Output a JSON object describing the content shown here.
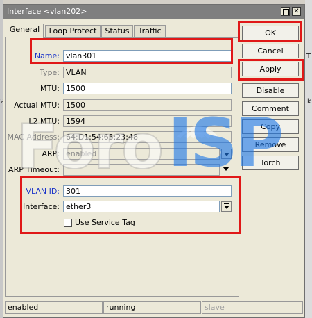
{
  "window": {
    "title": "Interface <vlan202>"
  },
  "tabs": [
    {
      "label": "General"
    },
    {
      "label": "Loop Protect"
    },
    {
      "label": "Status"
    },
    {
      "label": "Traffic"
    }
  ],
  "form": {
    "name": {
      "label": "Name:",
      "value": "vlan301"
    },
    "type": {
      "label": "Type:",
      "value": "VLAN"
    },
    "mtu": {
      "label": "MTU:",
      "value": "1500"
    },
    "actual_mtu": {
      "label": "Actual MTU:",
      "value": "1500"
    },
    "l2_mtu": {
      "label": "L2 MTU:",
      "value": "1594"
    },
    "mac": {
      "label": "MAC Address:",
      "value": "64:D1:54:65:23:48"
    },
    "arp": {
      "label": "ARP:",
      "value": "enabled"
    },
    "arp_timeout": {
      "label": "ARP Timeout:",
      "value": ""
    },
    "vlan_id": {
      "label": "VLAN ID:",
      "value": "301"
    },
    "interface": {
      "label": "Interface:",
      "value": "ether3"
    },
    "service_tag": {
      "label": "Use Service Tag",
      "checked": false
    }
  },
  "buttons": {
    "ok": "OK",
    "cancel": "Cancel",
    "apply": "Apply",
    "disable": "Disable",
    "comment": "Comment",
    "copy": "Copy",
    "remove": "Remove",
    "torch": "Torch"
  },
  "status_bar": [
    "enabled",
    "running",
    "slave"
  ],
  "background": {
    "frag_left": "2",
    "frag_right_1": "T",
    "frag_right_2": "k"
  },
  "watermark": {
    "part1": "Foro",
    "part2": "ISP"
  },
  "colors": {
    "highlight": "#e01818",
    "blue_label": "#1c35c9",
    "watermark_blue": "#1e78e6"
  }
}
